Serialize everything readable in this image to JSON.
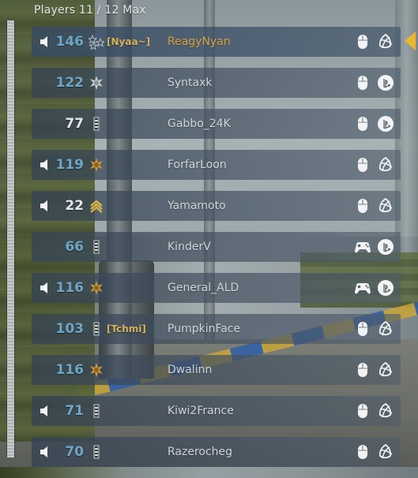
{
  "header": {
    "title": "Players 11 / 12 Max"
  },
  "colors": {
    "level_blue": "#6fa6c6",
    "level_white": "#e4e8ea",
    "name_gold": "#d9a441",
    "name_default": "#cfd5d8",
    "tag_gold": "#d5b25a",
    "marker": "#e8b830"
  },
  "players": [
    {
      "level": "146",
      "level_color": "blue",
      "speaker": true,
      "rank": "stars-rank-icon",
      "tag": "[Nyaa~]",
      "name": "ReagyNyan",
      "name_color": "gold",
      "input": "mouse-icon",
      "platform": "battlenet-icon"
    },
    {
      "level": "122",
      "level_color": "blue",
      "speaker": false,
      "rank": "star-burst-rank-icon",
      "tag": "",
      "name": "Syntaxk",
      "name_color": "default",
      "input": "mouse-icon",
      "platform": "playstation-icon"
    },
    {
      "level": "77",
      "level_color": "white",
      "speaker": false,
      "rank": "bar-rank-icon",
      "tag": "",
      "name": "Gabbo_24K",
      "name_color": "default",
      "input": "mouse-icon",
      "platform": "playstation-icon"
    },
    {
      "level": "119",
      "level_color": "blue",
      "speaker": true,
      "rank": "gold-star-rank-icon",
      "tag": "",
      "name": "ForfarLoon",
      "name_color": "default",
      "input": "mouse-icon",
      "platform": "battlenet-icon"
    },
    {
      "level": "22",
      "level_color": "white",
      "speaker": true,
      "rank": "chevron-rank-icon",
      "tag": "",
      "name": "Yamamoto",
      "name_color": "default",
      "input": "mouse-icon",
      "platform": "battlenet-icon"
    },
    {
      "level": "66",
      "level_color": "blue",
      "speaker": false,
      "rank": "bar-rank-icon",
      "tag": "",
      "name": "KinderV",
      "name_color": "default",
      "input": "gamepad-icon",
      "platform": "playstation-icon"
    },
    {
      "level": "116",
      "level_color": "blue",
      "speaker": true,
      "rank": "gold-star-rank-icon",
      "tag": "",
      "name": "General_ALD",
      "name_color": "default",
      "input": "gamepad-icon",
      "platform": "playstation-icon"
    },
    {
      "level": "103",
      "level_color": "blue",
      "speaker": false,
      "rank": "bar-rank-icon",
      "tag": "[Tchmi]",
      "name": "PumpkinFace",
      "name_color": "default",
      "input": "mouse-icon",
      "platform": "battlenet-icon"
    },
    {
      "level": "116",
      "level_color": "blue",
      "speaker": false,
      "rank": "gold-star-rank-icon",
      "tag": "",
      "name": "Dwalinn",
      "name_color": "default",
      "input": "mouse-icon",
      "platform": "battlenet-icon"
    },
    {
      "level": "71",
      "level_color": "blue",
      "speaker": true,
      "rank": "bar-rank-icon",
      "tag": "",
      "name": "Kiwi2France",
      "name_color": "default",
      "input": "mouse-icon",
      "platform": "battlenet-icon"
    },
    {
      "level": "70",
      "level_color": "blue",
      "speaker": true,
      "rank": "bar-rank-icon",
      "tag": "",
      "name": "Razerocheg",
      "name_color": "default",
      "input": "mouse-icon",
      "platform": "battlenet-icon"
    }
  ]
}
